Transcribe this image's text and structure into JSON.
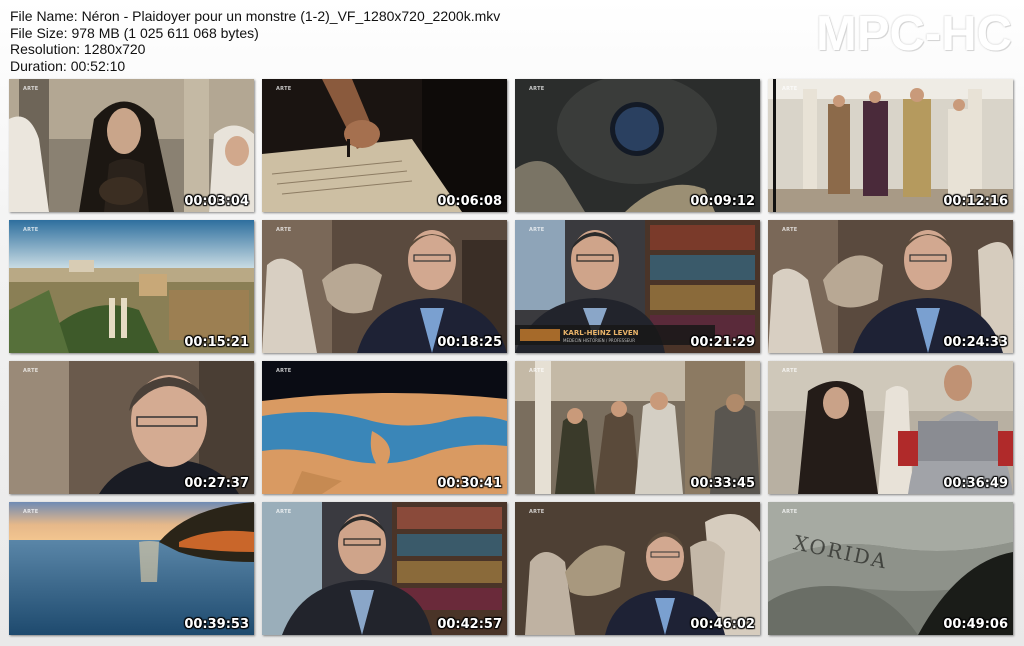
{
  "info": {
    "file_name": "File Name: Néron - Plaidoyer pour un monstre (1-2)_VF_1280x720_2200k.mkv",
    "file_size": "File Size: 978 MB (1 025 611 068 bytes)",
    "resolution": "Resolution: 1280x720",
    "duration": "Duration: 00:52:10"
  },
  "logo": "MPC-HC",
  "badge": "ARTE",
  "lower_third": {
    "name": "KARL-HEINZ LEVEN",
    "caption": "MÉDECIN HISTORIEN / PROFESSEUR"
  },
  "inscription": "XORIDA",
  "thumbnails": [
    {
      "time": "00:03:04",
      "scene": "veiled-woman"
    },
    {
      "time": "00:06:08",
      "scene": "hand-writing"
    },
    {
      "time": "00:09:12",
      "scene": "dome-oculus"
    },
    {
      "time": "00:12:16",
      "scene": "court-scene"
    },
    {
      "time": "00:15:21",
      "scene": "rome-aerial"
    },
    {
      "time": "00:18:25",
      "scene": "interview-statues"
    },
    {
      "time": "00:21:29",
      "scene": "interview-library"
    },
    {
      "time": "00:24:33",
      "scene": "interview-statues"
    },
    {
      "time": "00:27:37",
      "scene": "closeup-man"
    },
    {
      "time": "00:30:41",
      "scene": "map-relief"
    },
    {
      "time": "00:33:45",
      "scene": "crowd-scene"
    },
    {
      "time": "00:36:49",
      "scene": "soldier-scene"
    },
    {
      "time": "00:39:53",
      "scene": "sea-sunset"
    },
    {
      "time": "00:42:57",
      "scene": "man-bookshelf"
    },
    {
      "time": "00:46:02",
      "scene": "interview-wide"
    },
    {
      "time": "00:49:06",
      "scene": "stone-inscription"
    }
  ]
}
